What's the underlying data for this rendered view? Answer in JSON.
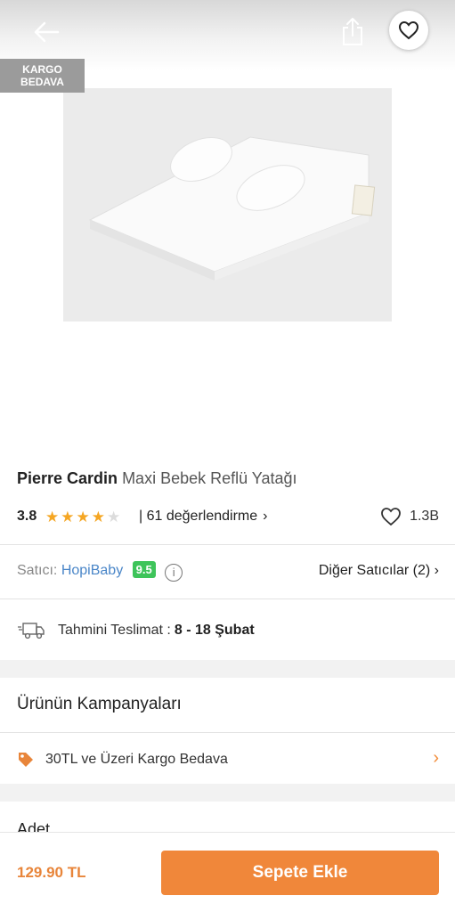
{
  "header": {
    "back_icon": "arrow-left-icon",
    "share_icon": "share-icon",
    "favorite_icon": "heart-icon"
  },
  "badge": {
    "line1": "KARGO",
    "line2": "BEDAVA"
  },
  "product": {
    "brand": "Pierre Cardin",
    "name": "Maxi Bebek Reflü Yatağı",
    "rating": "3.8",
    "rating_value": 3.8,
    "reviews": "| 61 değerlendirme",
    "likes": "1.3B"
  },
  "seller": {
    "label": "Satıcı:",
    "name": "HopiBaby",
    "score": "9.5",
    "info_icon_text": "i",
    "other_sellers": "Diğer Satıcılar (2)"
  },
  "delivery": {
    "label": "Tahmini Teslimat :",
    "range": "8 - 18 Şubat"
  },
  "campaigns": {
    "title": "Ürünün Kampanyaları",
    "item": "30TL ve Üzeri Kargo Bedava"
  },
  "quantity": {
    "label": "Adet"
  },
  "footer": {
    "price": "129.90 TL",
    "add_to_cart": "Sepete Ekle"
  },
  "colors": {
    "accent": "#f0873a",
    "star": "#f5a623",
    "seller_link": "#4a86c8",
    "score_badge": "#3ec45a"
  }
}
